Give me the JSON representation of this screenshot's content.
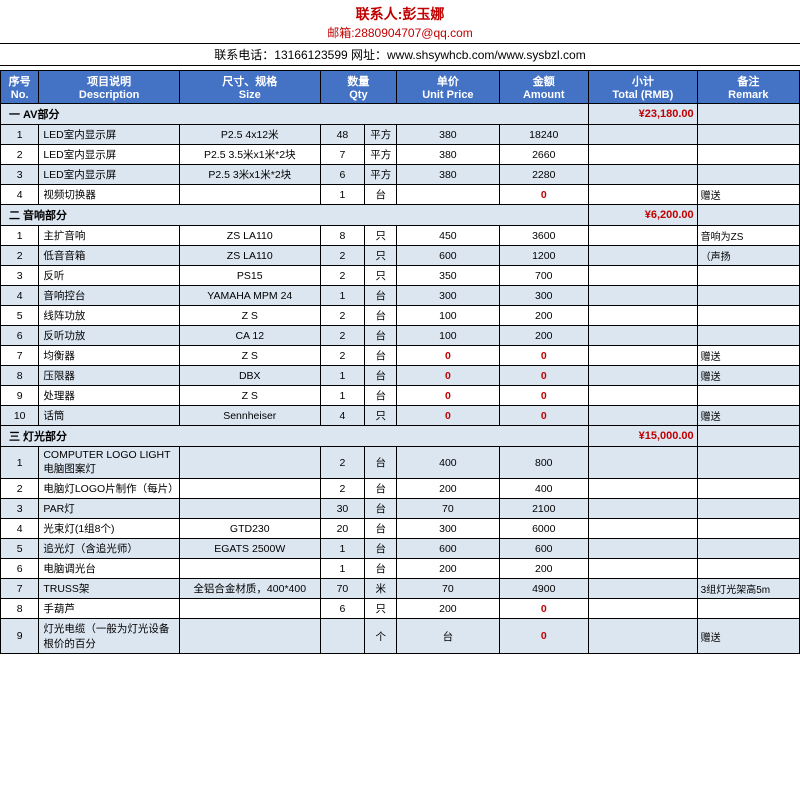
{
  "header": {
    "title": "联系人:彭玉娜",
    "email": "邮箱:2880904707@qq.com",
    "contact": "联系电话：13166123599     网址：www.shsywhcb.com/www.sysbzl.com"
  },
  "table": {
    "columns": [
      {
        "label": "序号",
        "sub": "No.",
        "name": "col-no"
      },
      {
        "label": "项目说明",
        "sub": "Description",
        "name": "col-desc"
      },
      {
        "label": "尺寸、规格",
        "sub": "Size",
        "name": "col-size"
      },
      {
        "label": "数量",
        "sub": "Qty",
        "name": "col-qty"
      },
      {
        "label": "",
        "sub": "",
        "name": "col-unit"
      },
      {
        "label": "单价",
        "sub": "Unit Price",
        "name": "col-price"
      },
      {
        "label": "",
        "sub": "",
        "name": "col-amount-spacer"
      },
      {
        "label": "金额",
        "sub": "Amount",
        "name": "col-amount"
      },
      {
        "label": "小计",
        "sub": "Total (RMB)",
        "name": "col-total"
      },
      {
        "label": "备注",
        "sub": "Remark",
        "name": "col-remark"
      }
    ],
    "sections": [
      {
        "name": "一 AV部分",
        "total": "¥23,180.00",
        "rows": [
          {
            "no": "1",
            "desc": "LED室内显示屏",
            "size": "P2.5  4x12米",
            "qty": "48",
            "unit": "平方",
            "price": "380",
            "amount": "18240",
            "total": "",
            "remark": ""
          },
          {
            "no": "2",
            "desc": "LED室内显示屏",
            "size": "P2.5  3.5米x1米*2块",
            "qty": "7",
            "unit": "平方",
            "price": "380",
            "amount": "2660",
            "total": "",
            "remark": ""
          },
          {
            "no": "3",
            "desc": "LED室内显示屏",
            "size": "P2.5  3米x1米*2块",
            "qty": "6",
            "unit": "平方",
            "price": "380",
            "amount": "2280",
            "total": "",
            "remark": ""
          },
          {
            "no": "4",
            "desc": "视频切换器",
            "size": "",
            "qty": "1",
            "unit": "台",
            "price": "",
            "amount": "0",
            "total": "",
            "remark": "赠送"
          }
        ]
      },
      {
        "name": "二 音响部分",
        "total": "¥6,200.00",
        "rows": [
          {
            "no": "1",
            "desc": "主扩音响",
            "size": "ZS LA110",
            "qty": "8",
            "unit": "只",
            "price": "450",
            "amount": "3600",
            "total": "",
            "remark": "音响为ZS"
          },
          {
            "no": "2",
            "desc": "低音音箱",
            "size": "ZS LA110",
            "qty": "2",
            "unit": "只",
            "price": "600",
            "amount": "1200",
            "total": "",
            "remark": "（声扬"
          },
          {
            "no": "3",
            "desc": "反听",
            "size": "PS15",
            "qty": "2",
            "unit": "只",
            "price": "350",
            "amount": "700",
            "total": "",
            "remark": ""
          },
          {
            "no": "4",
            "desc": "音响控台",
            "size": "YAMAHA MPM 24",
            "qty": "1",
            "unit": "台",
            "price": "300",
            "amount": "300",
            "total": "",
            "remark": ""
          },
          {
            "no": "5",
            "desc": "线阵功放",
            "size": "Z S",
            "qty": "2",
            "unit": "台",
            "price": "100",
            "amount": "200",
            "total": "",
            "remark": ""
          },
          {
            "no": "6",
            "desc": "反听功放",
            "size": "CA 12",
            "qty": "2",
            "unit": "台",
            "price": "100",
            "amount": "200",
            "total": "",
            "remark": ""
          },
          {
            "no": "7",
            "desc": "均衡器",
            "size": "Z S",
            "qty": "2",
            "unit": "台",
            "price": "0",
            "amount": "0",
            "total": "",
            "remark": "赠送"
          },
          {
            "no": "8",
            "desc": "压限器",
            "size": "DBX",
            "qty": "1",
            "unit": "台",
            "price": "0",
            "amount": "0",
            "total": "",
            "remark": "赠送"
          },
          {
            "no": "9",
            "desc": "处理器",
            "size": "Z S",
            "qty": "1",
            "unit": "台",
            "price": "0",
            "amount": "0",
            "total": "",
            "remark": ""
          },
          {
            "no": "10",
            "desc": "话筒",
            "size": "Sennheiser",
            "qty": "4",
            "unit": "只",
            "price": "0",
            "amount": "0",
            "total": "",
            "remark": "赠送"
          }
        ]
      },
      {
        "name": "三 灯光部分",
        "total": "¥15,000.00",
        "rows": [
          {
            "no": "1",
            "desc": "COMPUTER LOGO LIGHT电脑图案灯",
            "size": "",
            "qty": "2",
            "unit": "台",
            "price": "400",
            "amount": "800",
            "total": "",
            "remark": ""
          },
          {
            "no": "2",
            "desc": "电脑灯LOGO片制作（每片）",
            "size": "",
            "qty": "2",
            "unit": "台",
            "price": "200",
            "amount": "400",
            "total": "",
            "remark": ""
          },
          {
            "no": "3",
            "desc": "PAR灯",
            "size": "",
            "qty": "30",
            "unit": "台",
            "price": "70",
            "amount": "2100",
            "total": "",
            "remark": ""
          },
          {
            "no": "4",
            "desc": "光束灯(1组8个)",
            "size": "GTD230",
            "qty": "20",
            "unit": "台",
            "price": "300",
            "amount": "6000",
            "total": "",
            "remark": ""
          },
          {
            "no": "5",
            "desc": "追光灯（含追光师）",
            "size": "EGATS 2500W",
            "qty": "1",
            "unit": "台",
            "price": "600",
            "amount": "600",
            "total": "",
            "remark": ""
          },
          {
            "no": "6",
            "desc": "电脑调光台",
            "size": "",
            "qty": "1",
            "unit": "台",
            "price": "200",
            "amount": "200",
            "total": "",
            "remark": ""
          },
          {
            "no": "7",
            "desc": "TRUSS架",
            "size": "全铝合金材质，400*400",
            "qty": "70",
            "unit": "米",
            "price": "70",
            "amount": "4900",
            "total": "",
            "remark": "3组灯光架高5m"
          },
          {
            "no": "8",
            "desc": "手葫芦",
            "size": "",
            "qty": "6",
            "unit": "只",
            "price": "200",
            "amount": "0",
            "total": "",
            "remark": ""
          },
          {
            "no": "9",
            "desc": "灯光电缆（一般为灯光设备根价的百分",
            "size": "",
            "qty": "",
            "unit": "个",
            "price": "台",
            "amount": "0",
            "total": "",
            "remark": "赠送"
          }
        ]
      }
    ]
  }
}
